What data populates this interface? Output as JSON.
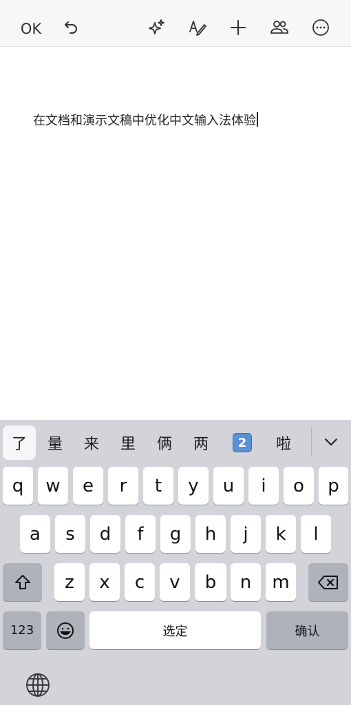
{
  "toolbar": {
    "ok_label": "OK",
    "icons": [
      "undo-icon",
      "sparkle-icon",
      "format-pen-icon",
      "add-icon",
      "share-people-icon",
      "more-icon"
    ]
  },
  "document": {
    "text": "在文档和演示文稿中优化中文输入法体验"
  },
  "keyboard": {
    "candidates": [
      "了",
      "量",
      "来",
      "里",
      "俩",
      "两",
      "2",
      "啦"
    ],
    "row1": [
      "q",
      "w",
      "e",
      "r",
      "t",
      "y",
      "u",
      "i",
      "o",
      "p"
    ],
    "row2": [
      "a",
      "s",
      "d",
      "f",
      "g",
      "h",
      "j",
      "k",
      "l"
    ],
    "row3": [
      "z",
      "x",
      "c",
      "v",
      "b",
      "n",
      "m"
    ],
    "numbers_label": "123",
    "space_label": "选定",
    "confirm_label": "确认"
  },
  "colors": {
    "keyboard_bg": "#d2d4da",
    "key_bg": "#ffffff",
    "key_dark_bg": "#aeb2bb",
    "emoji_badge": "#5b8fd6"
  }
}
